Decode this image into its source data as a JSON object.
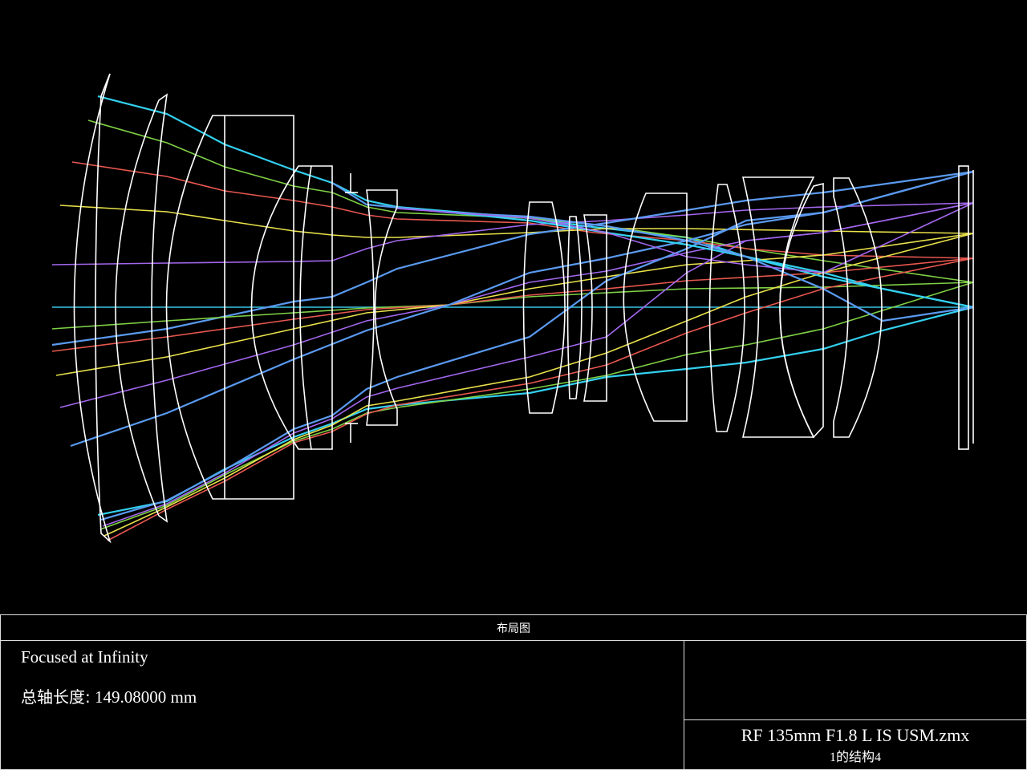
{
  "footer": {
    "title": "布局图",
    "focus": "Focused at Infinity",
    "length_label": "总轴长度:",
    "length_value": "149.08000 mm",
    "file_name": "RF 135mm F1.8 L IS USM.zmx",
    "config": "1的结构4"
  },
  "colors": {
    "background": "#000000",
    "lens": "#ffffff",
    "ray_axis": "#39c6e6",
    "ray_green": "#7fd045",
    "ray_red": "#e7574f",
    "ray_yellow": "#e9e14a",
    "ray_purple": "#a366ee",
    "ray_blue": "#5a9af0",
    "ray_cyan": "#33d0ef"
  },
  "rays": {
    "fields": [
      "cyan",
      "green",
      "red",
      "yellow",
      "purple",
      "blue"
    ]
  }
}
